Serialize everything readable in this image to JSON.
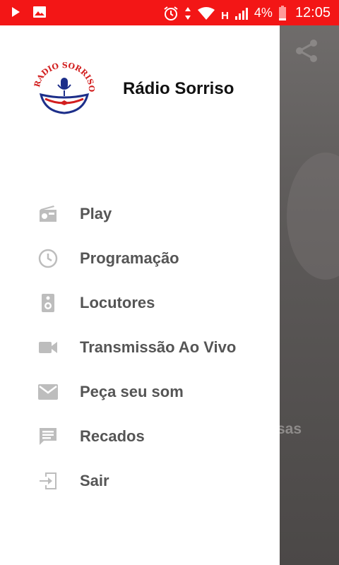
{
  "statusbar": {
    "network": "H",
    "battery": "4%",
    "time": "12:05",
    "color": "#f31616"
  },
  "drawer": {
    "title": "Rádio Sorriso",
    "logo_text": "RADIO SORRISO",
    "items": [
      {
        "label": "Play",
        "icon": "radio-icon"
      },
      {
        "label": "Programação",
        "icon": "clock-icon"
      },
      {
        "label": "Locutores",
        "icon": "speaker-icon"
      },
      {
        "label": "Transmissão Ao Vivo",
        "icon": "videocam-icon"
      },
      {
        "label": "Peça seu som",
        "icon": "mail-icon"
      },
      {
        "label": "Recados",
        "icon": "message-icon"
      },
      {
        "label": "Sair",
        "icon": "exit-icon"
      }
    ]
  },
  "background": {
    "partial_text": "sas"
  }
}
